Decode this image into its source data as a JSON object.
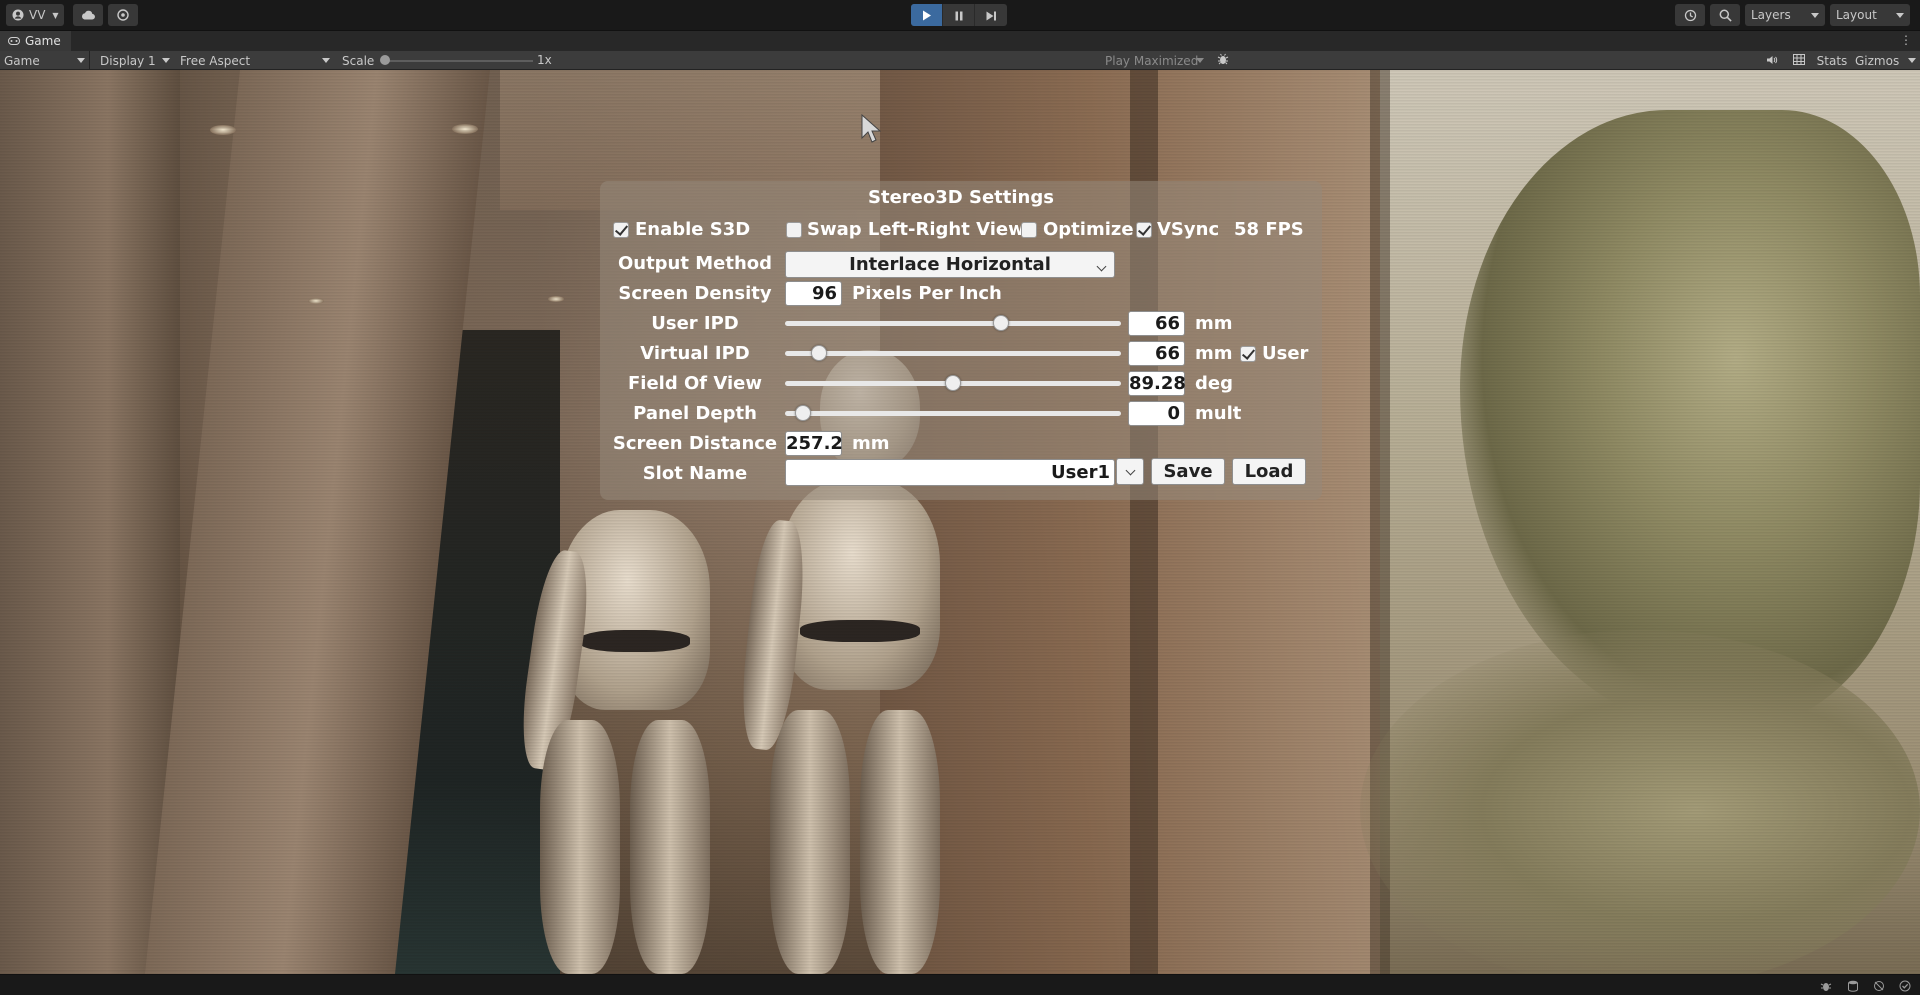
{
  "toolbar": {
    "account_label": "VV",
    "layers_label": "Layers",
    "layout_label": "Layout"
  },
  "tab": {
    "game_label": "Game"
  },
  "game_toolbar": {
    "view_label": "Game",
    "display_label": "Display 1",
    "aspect_label": "Free Aspect",
    "scale_label": "Scale",
    "scale_value": "1x",
    "play_mode_label": "Play Maximized",
    "stats_label": "Stats",
    "gizmos_label": "Gizmos"
  },
  "panel": {
    "title": "Stereo3D Settings",
    "enable_s3d": {
      "label": "Enable S3D",
      "checked": true
    },
    "swap_lr": {
      "label": "Swap Left-Right View",
      "checked": false
    },
    "optimize": {
      "label": "Optimize",
      "checked": false
    },
    "vsync": {
      "label": "VSync",
      "checked": true
    },
    "fps_text": "58 FPS",
    "output_method": {
      "label": "Output Method",
      "value": "Interlace Horizontal"
    },
    "screen_density": {
      "label": "Screen Density",
      "value": "96",
      "unit": "Pixels Per Inch"
    },
    "user_ipd": {
      "label": "User IPD",
      "value": "66",
      "unit": "mm",
      "slider_fraction": 0.65
    },
    "virtual_ipd": {
      "label": "Virtual IPD",
      "value": "66",
      "unit": "mm",
      "slider_fraction": 0.08,
      "user_checkbox": {
        "label": "User",
        "checked": true
      }
    },
    "field_of_view": {
      "label": "Field Of View",
      "value": "89.28",
      "unit": "deg",
      "slider_fraction": 0.5
    },
    "panel_depth": {
      "label": "Panel Depth",
      "value": "0",
      "unit": "mult",
      "slider_fraction": 0.03
    },
    "screen_distance": {
      "label": "Screen Distance",
      "value": "257.2",
      "unit": "mm"
    },
    "slot_name": {
      "label": "Slot Name",
      "value": "User1"
    },
    "save_label": "Save",
    "load_label": "Load"
  },
  "icons": {
    "account": "account-icon",
    "cloud": "cloud-icon",
    "collab": "collab-icon",
    "play": "play-icon",
    "pause": "pause-icon",
    "step": "step-icon",
    "history": "history-icon",
    "search": "search-icon",
    "bug": "bug-icon",
    "audio": "audio-mute-icon",
    "grid": "grid-icon"
  },
  "colors": {
    "play_active": "#3b6a9f",
    "editor_bg": "#191919",
    "panel_bg": "rgba(150,136,122,0.55)"
  }
}
